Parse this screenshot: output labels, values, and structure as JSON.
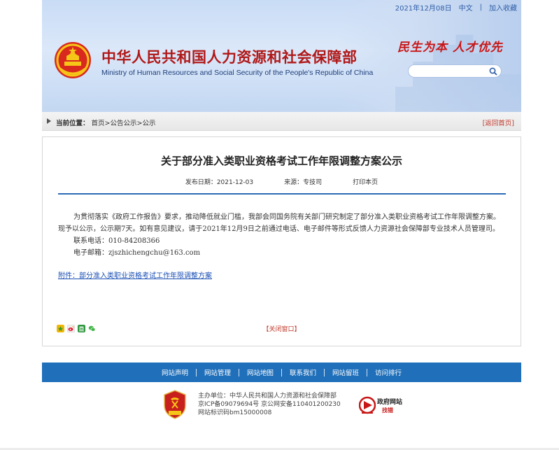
{
  "header": {
    "date": "2021年12月08日",
    "lang_link": "中文",
    "bookmark_link": "加入收藏",
    "title_cn": "中华人民共和国人力资源和社会保障部",
    "title_en": "Ministry of Human Resources and Social Security of the People's Republic of China",
    "slogan": "民生为本  人才优先",
    "search": {
      "placeholder": ""
    }
  },
  "breadcrumb": {
    "label": "当前位置：",
    "path": "首页>公告公示>公示",
    "back_home": "[返回首页]"
  },
  "article": {
    "title": "关于部分准入类职业资格考试工作年限调整方案公示",
    "publish_date_label": "发布日期：",
    "publish_date": "2021-12-03",
    "source_label": "来源：",
    "source": "专技司",
    "print": "打印本页",
    "paragraph": "为贯彻落实《政府工作报告》要求，推动降低就业门槛，我部会同国务院有关部门研究制定了部分准入类职业资格考试工作年限调整方案。现予以公示，公示期7天。如有意见建议，请于2021年12月9日之前通过电话、电子邮件等形式反馈人力资源社会保障部专业技术人员管理司。",
    "phone": "联系电话：010-84208366",
    "email": "电子邮箱：zjszhichengchu@163.com",
    "attachment": "附件：部分准入类职业资格考试工作年限调整方案",
    "close_window": "【关闭窗口】"
  },
  "footer": {
    "nav": [
      "网站声明",
      "网站管理",
      "网站地图",
      "联系我们",
      "网站留班",
      "访问排行"
    ],
    "sponsor": "主办单位：中华人民共和国人力资源和社会保障部",
    "icp": "京ICP备09079694号 京公网安备110401200230",
    "site_id": "网站标识码bm15000008",
    "gov_badge_line1": "政府网站",
    "gov_badge_line2": "找错"
  },
  "colors": {
    "brand_red": "#b01818",
    "nav_blue": "#1f6fba",
    "rule_blue": "#2d6cb5",
    "link_blue": "#1a4fb4"
  },
  "icons": [
    "national-emblem-icon",
    "search-icon",
    "breadcrumb-arrow-icon",
    "share-icons",
    "party-badge-icon",
    "gov-site-error-icon"
  ]
}
